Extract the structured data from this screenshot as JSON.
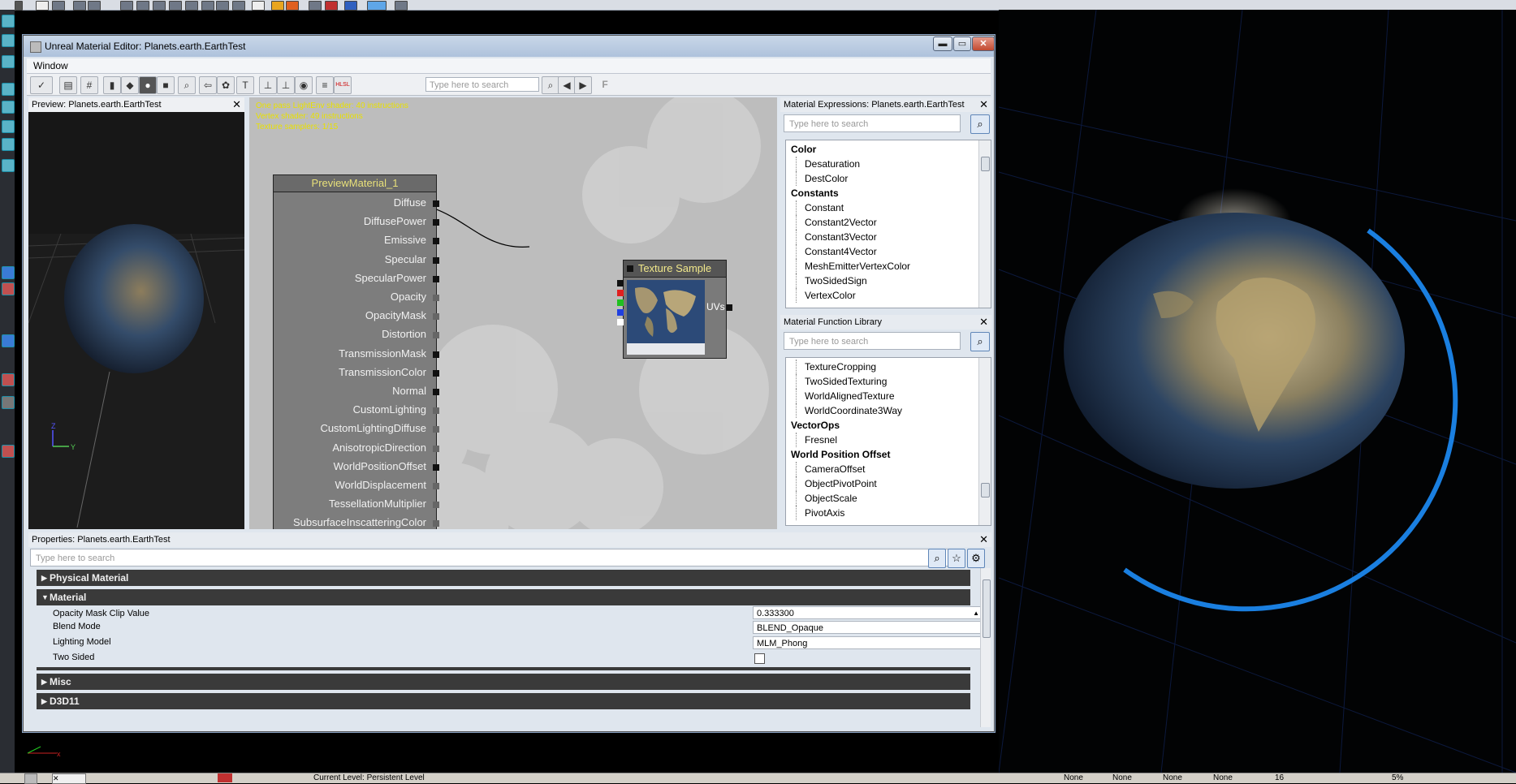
{
  "window": {
    "title": "Unreal Material Editor: Planets.earth.EarthTest",
    "minimize": "▬",
    "maximize": "▭",
    "close": "✕"
  },
  "menu": {
    "window": "Window"
  },
  "toolbar": {
    "search_placeholder": "Type here to search",
    "hlsl_label": "HLSL",
    "f_label": "F"
  },
  "preview": {
    "header": "Preview: Planets.earth.EarthTest",
    "axis_z": "Z",
    "axis_y": "Y"
  },
  "graph": {
    "stats": [
      "One pass LightEnv shader: 40 instructions",
      "Vertex shader: 49 instructions",
      "Texture samplers: 1/15"
    ],
    "material_node": {
      "title": "PreviewMaterial_1",
      "pins": [
        {
          "label": "Diffuse",
          "active": true
        },
        {
          "label": "DiffusePower",
          "active": true
        },
        {
          "label": "Emissive",
          "active": true
        },
        {
          "label": "Specular",
          "active": true
        },
        {
          "label": "SpecularPower",
          "active": true
        },
        {
          "label": "Opacity",
          "active": false
        },
        {
          "label": "OpacityMask",
          "active": false
        },
        {
          "label": "Distortion",
          "active": false
        },
        {
          "label": "TransmissionMask",
          "active": true
        },
        {
          "label": "TransmissionColor",
          "active": true
        },
        {
          "label": "Normal",
          "active": true
        },
        {
          "label": "CustomLighting",
          "active": false
        },
        {
          "label": "CustomLightingDiffuse",
          "active": false
        },
        {
          "label": "AnisotropicDirection",
          "active": false
        },
        {
          "label": "WorldPositionOffset",
          "active": true
        },
        {
          "label": "WorldDisplacement",
          "active": false
        },
        {
          "label": "TessellationMultiplier",
          "active": false
        },
        {
          "label": "SubsurfaceInscatteringColor",
          "active": false
        }
      ]
    },
    "texture_node": {
      "title": "Texture Sample",
      "output_label": "UVs",
      "channel_colors": [
        "#111111",
        "#e02020",
        "#20c020",
        "#2040e0",
        "#ffffff"
      ]
    }
  },
  "expressions": {
    "header": "Material Expressions: Planets.earth.EarthTest",
    "search_placeholder": "Type here to search",
    "rows": [
      {
        "text": "Color",
        "cat": true
      },
      {
        "text": "Desaturation",
        "cat": false
      },
      {
        "text": "DestColor",
        "cat": false
      },
      {
        "text": "Constants",
        "cat": true
      },
      {
        "text": "Constant",
        "cat": false
      },
      {
        "text": "Constant2Vector",
        "cat": false
      },
      {
        "text": "Constant3Vector",
        "cat": false
      },
      {
        "text": "Constant4Vector",
        "cat": false
      },
      {
        "text": "MeshEmitterVertexColor",
        "cat": false
      },
      {
        "text": "TwoSidedSign",
        "cat": false
      },
      {
        "text": "VertexColor",
        "cat": false
      }
    ]
  },
  "functions": {
    "header": "Material Function Library",
    "search_placeholder": "Type here to search",
    "rows": [
      {
        "text": "TextureCropping",
        "cat": false
      },
      {
        "text": "TwoSidedTexturing",
        "cat": false
      },
      {
        "text": "WorldAlignedTexture",
        "cat": false
      },
      {
        "text": "WorldCoordinate3Way",
        "cat": false
      },
      {
        "text": "VectorOps",
        "cat": true
      },
      {
        "text": "Fresnel",
        "cat": false
      },
      {
        "text": "World Position Offset",
        "cat": true
      },
      {
        "text": "CameraOffset",
        "cat": false
      },
      {
        "text": "ObjectPivotPoint",
        "cat": false
      },
      {
        "text": "ObjectScale",
        "cat": false
      },
      {
        "text": "PivotAxis",
        "cat": false
      }
    ]
  },
  "properties": {
    "header": "Properties: Planets.earth.EarthTest",
    "search_placeholder": "Type here to search",
    "categories": {
      "physical_material": "Physical Material",
      "material": "Material",
      "misc": "Misc",
      "d3d11": "D3D11"
    },
    "fields": {
      "opacity_mask_clip_label": "Opacity Mask Clip Value",
      "opacity_mask_clip_value": "0.333300",
      "blend_mode_label": "Blend Mode",
      "blend_mode_value": "BLEND_Opaque",
      "lighting_model_label": "Lighting Model",
      "lighting_model_value": "MLM_Phong",
      "two_sided_label": "Two Sided"
    }
  },
  "statusbar": {
    "current_level": "Current Level: Persistent Level",
    "none_labels": [
      "None",
      "None",
      "None",
      "None"
    ],
    "grid_value": "16",
    "zoom_value": "5%"
  },
  "colors": {
    "accent_blue": "#1a7fe0",
    "graph_bg": "#bdbdbd",
    "stats_yellow": "#e8e000"
  }
}
